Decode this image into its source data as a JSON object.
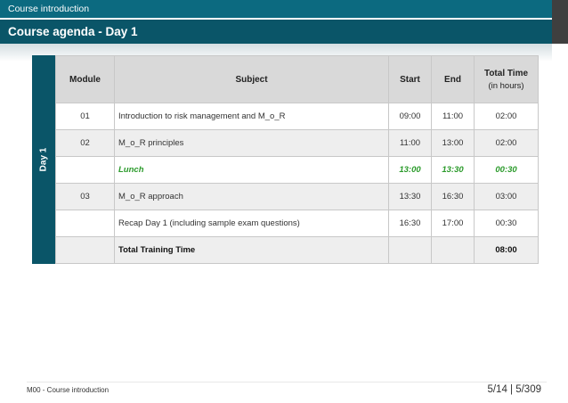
{
  "header": {
    "section": "Course introduction",
    "title": "Course agenda - Day 1"
  },
  "side_label": "Day 1",
  "table": {
    "columns": {
      "module": "Module",
      "subject": "Subject",
      "start": "Start",
      "end": "End",
      "total": "Total Time",
      "total_sub": "(in hours)"
    },
    "rows": [
      {
        "module": "01",
        "subject": "Introduction to risk management and M_o_R",
        "start": "09:00",
        "end": "11:00",
        "total": "02:00"
      },
      {
        "module": "02",
        "subject": "M_o_R principles",
        "start": "11:00",
        "end": "13:00",
        "total": "02:00"
      },
      {
        "module": "",
        "subject": "Lunch",
        "start": "13:00",
        "end": "13:30",
        "total": "00:30"
      },
      {
        "module": "03",
        "subject": "M_o_R approach",
        "start": "13:30",
        "end": "16:30",
        "total": "03:00"
      },
      {
        "module": "",
        "subject": "Recap Day 1 (including sample exam questions)",
        "start": "16:30",
        "end": "17:00",
        "total": "00:30"
      },
      {
        "module": "",
        "subject": "Total Training Time",
        "start": "",
        "end": "",
        "total": "08:00"
      }
    ]
  },
  "footer": {
    "label": "M00 - Course introduction",
    "page": "5/14 | 5/309"
  },
  "colors": {
    "header_top": "#0c6a80",
    "header_main": "#0a5568",
    "lunch_text": "#2a9a2a"
  }
}
